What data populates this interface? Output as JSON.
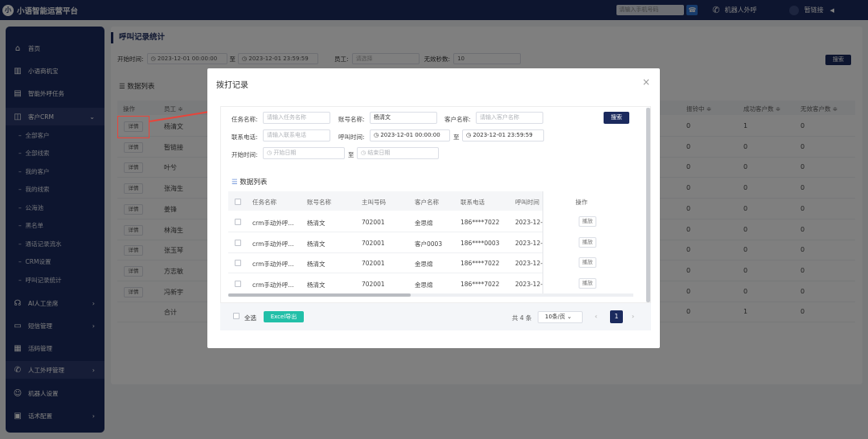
{
  "app": {
    "title": "小语智能运营平台",
    "logo_char": "小"
  },
  "topbar": {
    "search_placeholder": "请输入手机号码",
    "phone_icon": "☎",
    "robot_label": "机器人外呼",
    "user_name": "暂链接",
    "caret": "◀"
  },
  "sidebar": {
    "items": [
      {
        "label": "首页",
        "icon": "home-icon",
        "glyph": "⌂"
      },
      {
        "label": "小语商机宝",
        "icon": "bars-icon",
        "glyph": "▥"
      },
      {
        "label": "智能外呼任务",
        "icon": "task-icon",
        "glyph": "▤"
      },
      {
        "label": "客户CRM",
        "icon": "crm-icon",
        "glyph": "◫",
        "arrow": "⌄"
      },
      {
        "label": "AI人工坐席",
        "icon": "agent-icon",
        "glyph": "☊",
        "arrow": "›"
      },
      {
        "label": "短信管理",
        "icon": "sms-icon",
        "glyph": "▭",
        "arrow": "›"
      },
      {
        "label": "活码管理",
        "icon": "qrcode-icon",
        "glyph": "▦"
      },
      {
        "label": "人工外呼管理",
        "icon": "phone-icon",
        "glyph": "✆",
        "arrow": "›"
      },
      {
        "label": "机器人设置",
        "icon": "robot-icon",
        "glyph": "☺"
      },
      {
        "label": "话术配置",
        "icon": "script-icon",
        "glyph": "▣",
        "arrow": "›"
      }
    ],
    "sub_items": [
      "全部客户",
      "全部线索",
      "我的客户",
      "我的线索",
      "公海池",
      "黑名单",
      "通话记录流水",
      "CRM设置",
      "呼叫记录统计"
    ]
  },
  "page": {
    "title": "呼叫记录统计",
    "filters": {
      "start_label": "开始时间:",
      "start_value": "2023-12-01 00:00:00",
      "to": "至",
      "end_value": "2023-12-01 23:59:59",
      "staff_label": "员工:",
      "staff_placeholder": "请选择",
      "invalid_label": "无效秒数:",
      "invalid_value": "10",
      "search": "搜索"
    },
    "list_title": "数据列表",
    "table": {
      "headers": [
        "操作",
        "员工 ≑",
        "",
        "",
        "",
        "",
        "",
        "",
        "振铃中 ≑",
        "成功客户数 ≑",
        "无效客户数 ≑"
      ],
      "detail_label": "详情",
      "rows": [
        {
          "name": "杨清文",
          "c1": "0",
          "c2": "1",
          "c3": "0"
        },
        {
          "name": "暂链接",
          "c1": "0",
          "c2": "0",
          "c3": "0"
        },
        {
          "name": "叶兮",
          "c1": "0",
          "c2": "0",
          "c3": "0"
        },
        {
          "name": "张海生",
          "c1": "0",
          "c2": "0",
          "c3": "0"
        },
        {
          "name": "姜锋",
          "c1": "0",
          "c2": "0",
          "c3": "0"
        },
        {
          "name": "林海生",
          "c1": "0",
          "c2": "0",
          "c3": "0"
        },
        {
          "name": "张玉琴",
          "c1": "0",
          "c2": "0",
          "c3": "0"
        },
        {
          "name": "方志敏",
          "c1": "0",
          "c2": "0",
          "c3": "0"
        },
        {
          "name": "冯新宇",
          "c1": "0",
          "c2": "0",
          "c3": "0"
        }
      ],
      "total_row": {
        "name": "合计",
        "c1": "0",
        "c2": "1",
        "c3": "0"
      }
    }
  },
  "modal": {
    "title": "拨打记录",
    "close": "×",
    "form": {
      "task_label": "任务名称:",
      "task_placeholder": "请输入任务名称",
      "account_label": "账号名称:",
      "account_value": "杨清文",
      "customer_label": "客户名称:",
      "customer_placeholder": "请输入客户名称",
      "phone_label": "联系电话:",
      "phone_placeholder": "请输入联系电话",
      "calltime_label": "呼叫时间:",
      "calltime_start": "2023-12-01 00:00:00",
      "to": "至",
      "calltime_end": "2023-12-01 23:59:59",
      "starttime_label": "开始时间:",
      "start_placeholder": "开始日期",
      "end_placeholder": "结束日期",
      "search": "搜索"
    },
    "list_title": "数据列表",
    "headers": [
      "任务名称",
      "账号名称",
      "主叫号码",
      "客户名称",
      "联系电话",
      "呼叫时间",
      "操作"
    ],
    "rows": [
      {
        "task": "crm手动外呼...",
        "account": "杨清文",
        "caller": "702001",
        "customer": "金思绵",
        "phone": "186****7022",
        "time": "2023-12-",
        "op": "播放"
      },
      {
        "task": "crm手动外呼...",
        "account": "杨清文",
        "caller": "702001",
        "customer": "客户0003",
        "phone": "186****0003",
        "time": "2023-12-",
        "op": "播放"
      },
      {
        "task": "crm手动外呼...",
        "account": "杨清文",
        "caller": "702001",
        "customer": "金思绵",
        "phone": "186****7022",
        "time": "2023-12-",
        "op": "播放"
      },
      {
        "task": "crm手动外呼...",
        "account": "杨清文",
        "caller": "702001",
        "customer": "金思绵",
        "phone": "186****7022",
        "time": "2023-12-",
        "op": "播放"
      }
    ],
    "footer": {
      "select_all": "全选",
      "export": "Excel导出",
      "total": "共 4 条",
      "page_size": "10条/页",
      "page_size_caret": "⌄",
      "prev": "‹",
      "current": "1",
      "next": "›"
    }
  },
  "colors": {
    "navy": "#1b2a5e",
    "teal": "#22bfa8",
    "red": "#e8443a"
  }
}
